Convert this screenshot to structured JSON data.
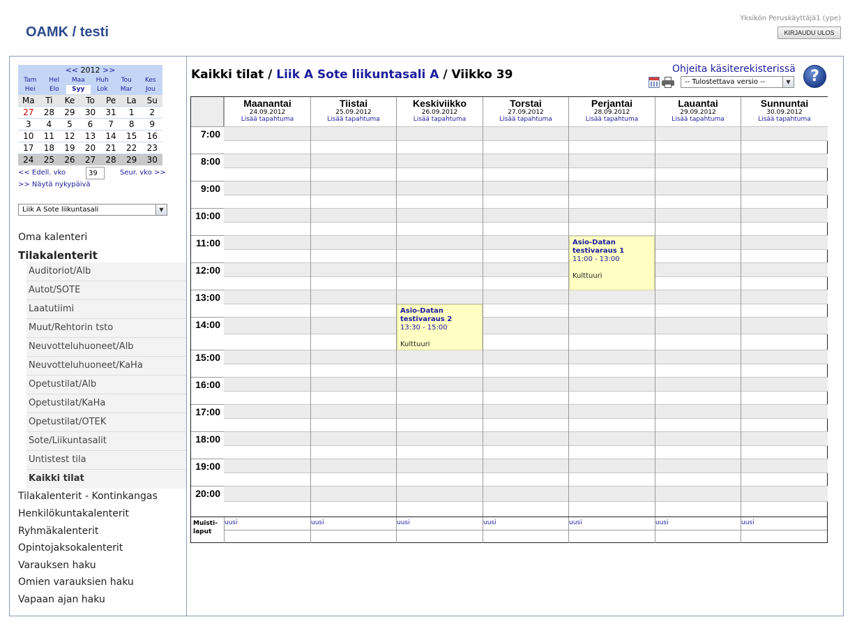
{
  "header": {
    "app_title": "OAMK / testi",
    "user": "Yksikön Peruskäyttäjä1 (ype)",
    "logout_label": "KIRJAUDU ULOS"
  },
  "mini_calendar": {
    "prev_year": "<<",
    "year": "2012",
    "next_year": ">>",
    "months_row1": [
      "Tam",
      "Hel",
      "Maa",
      "Huh",
      "Tou",
      "Kes"
    ],
    "months_row2": [
      "Hei",
      "Elo",
      "Syy",
      "Lok",
      "Mar",
      "Jou"
    ],
    "selected_month": "Syy",
    "weekdays": [
      "Ma",
      "Ti",
      "Ke",
      "To",
      "Pe",
      "La",
      "Su"
    ],
    "weeks": [
      [
        "27",
        "28",
        "29",
        "30",
        "31",
        "1",
        "2"
      ],
      [
        "3",
        "4",
        "5",
        "6",
        "7",
        "8",
        "9"
      ],
      [
        "10",
        "11",
        "12",
        "13",
        "14",
        "15",
        "16"
      ],
      [
        "17",
        "18",
        "19",
        "20",
        "21",
        "22",
        "23"
      ],
      [
        "24",
        "25",
        "26",
        "27",
        "28",
        "29",
        "30"
      ]
    ],
    "prev_week_label": "<< Edell. vko",
    "week_number": "39",
    "next_week_label": "Seur. vko >>",
    "today_label": ">> Näytä nykypäivä"
  },
  "space_select": {
    "value": "Liik A Sote liikuntasali"
  },
  "nav": {
    "own_calendar": "Oma kalenteri",
    "space_calendars": "Tilakalenterit",
    "sub_items": [
      "Auditoriot/Alb",
      "Autot/SOTE",
      "Laatutiimi",
      "Muut/Rehtorin tsto",
      "Neuvotteluhuoneet/Alb",
      "Neuvotteluhuoneet/KaHa",
      "Opetustilat/Alb",
      "Opetustilat/KaHa",
      "Opetustilat/OTEK",
      "Sote/Liikuntasalit",
      "Untistest tila",
      "Kaikki tilat"
    ],
    "bottom_items": [
      "Tilakalenterit - Kontinkangas",
      "Henkilökuntakalenterit",
      "Ryhmäkalenterit",
      "Opintojaksokalenterit",
      "Varauksen haku",
      "Omien varauksien haku",
      "Vapaan ajan haku"
    ]
  },
  "main": {
    "heading_prefix": "Kaikki tilat / ",
    "heading_space": "Liik A Sote liikuntasali A",
    "heading_suffix": " / Viikko 39",
    "help_link": "Ohjeita käsiterekisterissä",
    "help_icon_glyph": "?",
    "print_select_value": "-- Tulostettava versio --",
    "add_event_label": "Lisää tapahtuma",
    "days": [
      {
        "name": "Maanantai",
        "date": "24.09.2012"
      },
      {
        "name": "Tiistai",
        "date": "25.09.2012"
      },
      {
        "name": "Keskiviikko",
        "date": "26.09.2012"
      },
      {
        "name": "Torstai",
        "date": "27.09.2012"
      },
      {
        "name": "Perjantai",
        "date": "28.09.2012"
      },
      {
        "name": "Lauantai",
        "date": "29.09.2012"
      },
      {
        "name": "Sunnuntai",
        "date": "30.09.2012"
      }
    ],
    "hours": [
      "7:00",
      "8:00",
      "9:00",
      "10:00",
      "11:00",
      "12:00",
      "13:00",
      "14:00",
      "15:00",
      "16:00",
      "17:00",
      "18:00",
      "19:00",
      "20:00"
    ],
    "notes_label_line1": "Muisti-",
    "notes_label_line2": "laput",
    "new_note_label": "uusi",
    "events": [
      {
        "day_index": 4,
        "title": "Asio-Datan testivaraus 1",
        "time": "11:00 - 13:00",
        "place": "Kulttuuri"
      },
      {
        "day_index": 2,
        "title": "Asio-Datan testivaraus 2",
        "time": "13:30 - 15:00",
        "place": "Kulttuuri"
      }
    ]
  }
}
